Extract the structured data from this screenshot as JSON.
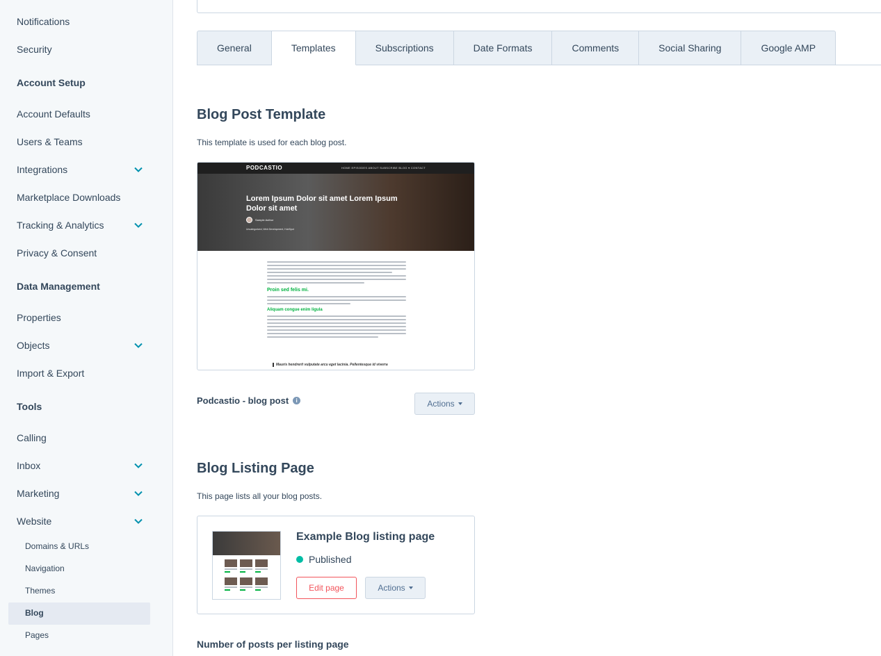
{
  "sidebar": {
    "items": [
      {
        "label": "Notifications"
      },
      {
        "label": "Security"
      },
      {
        "label": "Account Setup"
      },
      {
        "label": "Account Defaults"
      },
      {
        "label": "Users & Teams"
      },
      {
        "label": "Integrations"
      },
      {
        "label": "Marketplace Downloads"
      },
      {
        "label": "Tracking & Analytics"
      },
      {
        "label": "Privacy & Consent"
      },
      {
        "label": "Data Management"
      },
      {
        "label": "Properties"
      },
      {
        "label": "Objects"
      },
      {
        "label": "Import & Export"
      },
      {
        "label": "Tools"
      },
      {
        "label": "Calling"
      },
      {
        "label": "Inbox"
      },
      {
        "label": "Marketing"
      },
      {
        "label": "Website"
      }
    ],
    "website_sub": [
      "Domains & URLs",
      "Navigation",
      "Themes",
      "Blog",
      "Pages"
    ],
    "active_sub": "Blog"
  },
  "tabs": [
    "General",
    "Templates",
    "Subscriptions",
    "Date Formats",
    "Comments",
    "Social Sharing",
    "Google AMP"
  ],
  "active_tab": "Templates",
  "post_template": {
    "heading": "Blog Post Template",
    "description": "This template is used for each blog post.",
    "preview": {
      "logo": "PODCASTIO",
      "nav": "HOME   EPISODES   ABOUT   SUBSCRIBE   BLOG ▾   CONTACT",
      "title": "Lorem Ipsum Dolor sit amet Lorem Ipsum Dolor sit amet",
      "author": "Sample Author",
      "tags": "Uncategorized, Web Development, HubSpot",
      "h1": "Proin sed felis mi.",
      "h2": "Aliquam congue enim ligula",
      "quote": "Mauris hendrerit vulputate arcu eget lacinia. Pellentesque id viverra"
    },
    "name": "Podcastio - blog post",
    "actions_label": "Actions"
  },
  "listing": {
    "heading": "Blog Listing Page",
    "description": "This page lists all your blog posts.",
    "title": "Example Blog listing page",
    "status": "Published",
    "edit_label": "Edit page",
    "actions_label": "Actions"
  },
  "posts_per_page_label": "Number of posts per listing page",
  "colors": {
    "accent": "#00bda5",
    "edit": "#f2545b",
    "sidebar_bg": "#f5f8fa"
  }
}
